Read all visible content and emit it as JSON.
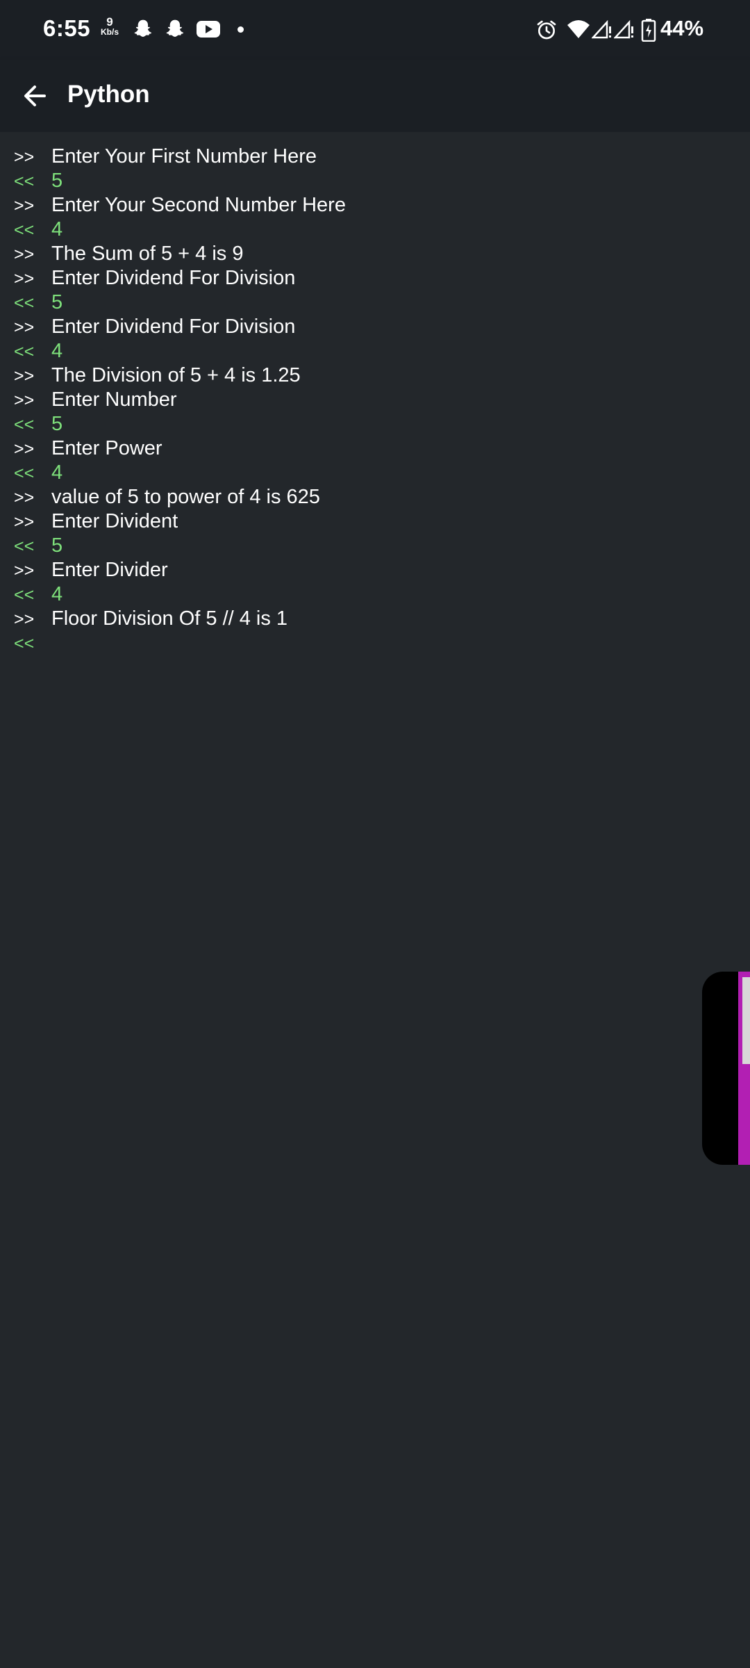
{
  "status_bar": {
    "time": "6:55",
    "net_speed_value": "9",
    "net_speed_unit": "Kb/s",
    "notification_icons": [
      "snapchat-icon",
      "snapchat-icon",
      "youtube-icon"
    ],
    "right_icons": [
      "alarm-icon",
      "wifi-icon",
      "signal-icon",
      "signal-icon",
      "battery-charging-icon"
    ],
    "battery": "44%"
  },
  "app_bar": {
    "title": "Python",
    "back_icon": "arrow-left-icon"
  },
  "console": {
    "prompt_out": ">>",
    "prompt_in": "<<",
    "colors": {
      "output": "#ffffff",
      "input": "#7ee07b",
      "background": "#23272b",
      "appbar": "#1b1f24"
    },
    "lines": [
      {
        "kind": "out",
        "text": "Enter Your First Number Here"
      },
      {
        "kind": "in",
        "text": "5"
      },
      {
        "kind": "out",
        "text": "Enter Your Second Number Here"
      },
      {
        "kind": "in",
        "text": "4"
      },
      {
        "kind": "out",
        "text": "The Sum of 5 + 4 is 9"
      },
      {
        "kind": "out",
        "text": "Enter Dividend For Division"
      },
      {
        "kind": "in",
        "text": "5"
      },
      {
        "kind": "out",
        "text": "Enter Dividend For Division"
      },
      {
        "kind": "in",
        "text": "4"
      },
      {
        "kind": "out",
        "text": "The Division of 5 + 4 is 1.25"
      },
      {
        "kind": "out",
        "text": "Enter Number"
      },
      {
        "kind": "in",
        "text": "5"
      },
      {
        "kind": "out",
        "text": "Enter Power"
      },
      {
        "kind": "in",
        "text": "4"
      },
      {
        "kind": "out",
        "text": "value of 5 to power of 4 is 625"
      },
      {
        "kind": "out",
        "text": "Enter Divident"
      },
      {
        "kind": "in",
        "text": "5"
      },
      {
        "kind": "out",
        "text": "Enter Divider"
      },
      {
        "kind": "in",
        "text": "4"
      },
      {
        "kind": "out",
        "text": "Floor Division Of 5 // 4 is 1"
      },
      {
        "kind": "in",
        "text": ""
      }
    ]
  }
}
